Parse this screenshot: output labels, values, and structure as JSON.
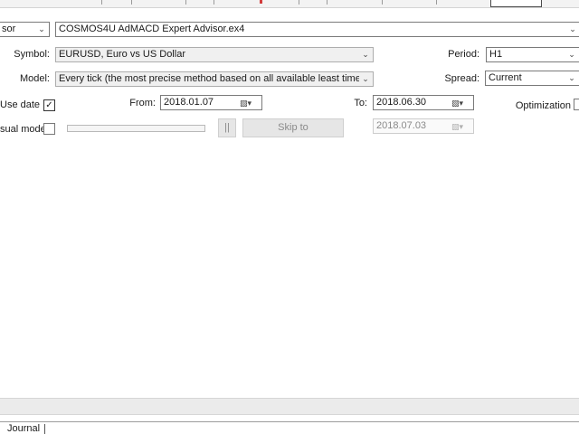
{
  "tester": {
    "expert_type": "sor",
    "expert_file": "COSMOS4U AdMACD Expert Advisor.ex4",
    "symbol_label": "Symbol:",
    "symbol_value": "EURUSD, Euro vs US Dollar",
    "period_label": "Period:",
    "period_value": "H1",
    "model_label": "Model:",
    "model_value": "Every tick (the most precise method based on all available least timeframes t",
    "spread_label": "Spread:",
    "spread_value": "Current",
    "use_date_label": "Use date",
    "use_date_checked": "✓",
    "from_label": "From:",
    "from_value": "2018.01.07",
    "to_label": "To:",
    "to_value": "2018.06.30",
    "optimization_label": "Optimization",
    "visual_mode_label": "sual mode",
    "pause_label": "||",
    "skip_to_label": "Skip to",
    "skip_to_date": "2018.07.03"
  },
  "tabs": {
    "journal": "Journal"
  },
  "icons": {
    "dropdown": "chevron-down-icon",
    "calendar": "calendar-icon"
  }
}
